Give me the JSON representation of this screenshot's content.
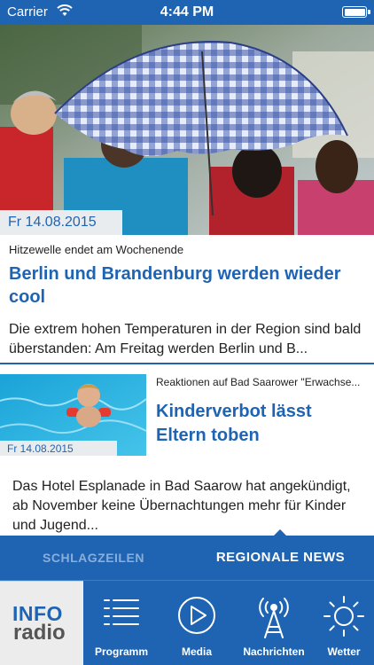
{
  "status_bar": {
    "carrier": "Carrier",
    "time": "4:44 PM"
  },
  "hero": {
    "date": "Fr 14.08.2015"
  },
  "article1": {
    "kicker": "Hitzewelle endet am Wochenende",
    "headline": "Berlin und Brandenburg werden wieder cool",
    "teaser": "Die extrem hohen Temperaturen in der Region sind bald überstanden: Am Freitag werden Berlin und B..."
  },
  "article2": {
    "date": "Fr 14.08.2015",
    "kicker": "Reaktionen auf Bad Saarower \"Erwachse...",
    "headline": "Kinderverbot lässt Eltern toben",
    "teaser": "Das Hotel Esplanade in Bad Saarow hat angekündigt, ab November keine Übernachtungen mehr für Kinder und Jugend..."
  },
  "section_tabs": {
    "left": "SCHLAGZEILEN",
    "right": "REGIONALE NEWS",
    "active": "REGIONALE NEWS"
  },
  "logo": {
    "line1": "INFO",
    "line2": "radio"
  },
  "nav": [
    {
      "label": "Programm",
      "icon": "list-icon"
    },
    {
      "label": "Media",
      "icon": "play-icon"
    },
    {
      "label": "Nachrichten",
      "icon": "radio-tower-icon"
    },
    {
      "label": "Wetter",
      "icon": "sun-icon"
    }
  ],
  "colors": {
    "brand_blue": "#1f64b3",
    "tab_inactive": "#89aed9",
    "date_bg": "#e9ecef"
  }
}
